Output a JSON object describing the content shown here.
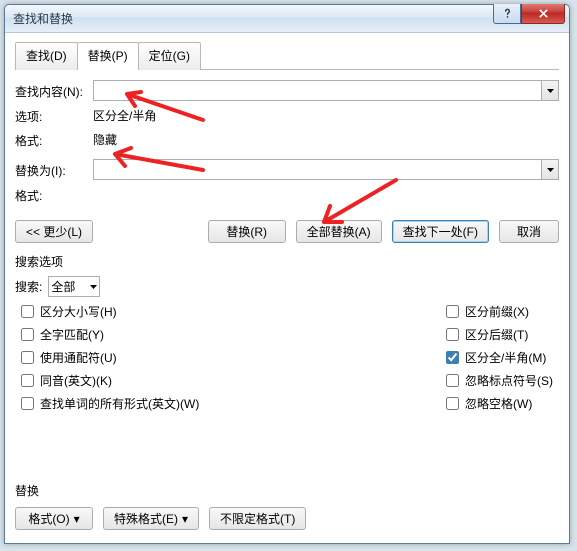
{
  "window": {
    "title": "查找和替换"
  },
  "tabs": {
    "find": "查找(D)",
    "replace": "替换(P)",
    "goto": "定位(G)"
  },
  "find": {
    "label": "查找内容(N):",
    "value": "",
    "options_lbl": "选项:",
    "options_val": "区分全/半角",
    "format_lbl": "格式:",
    "format_val": "隐藏"
  },
  "replace": {
    "label": "替换为(I):",
    "value": "",
    "format_lbl": "格式:"
  },
  "buttons": {
    "less": "<< 更少(L)",
    "replace_one": "替换(R)",
    "replace_all": "全部替换(A)",
    "find_next": "查找下一处(F)",
    "cancel": "取消"
  },
  "search_opts": {
    "header": "搜索选项",
    "search_lbl": "搜索:",
    "search_val": "全部",
    "left": {
      "case": "区分大小写(H)",
      "whole": "全字匹配(Y)",
      "wildcard": "使用通配符(U)",
      "sounds": "同音(英文)(K)",
      "wordforms": "查找单词的所有形式(英文)(W)"
    },
    "right": {
      "prefix": "区分前缀(X)",
      "suffix": "区分后缀(T)",
      "fullhalf": "区分全/半角(M)",
      "punct": "忽略标点符号(S)",
      "space": "忽略空格(W)"
    }
  },
  "footer": {
    "label": "替换",
    "format": "格式(O)",
    "special": "特殊格式(E)",
    "nofmt": "不限定格式(T)"
  }
}
